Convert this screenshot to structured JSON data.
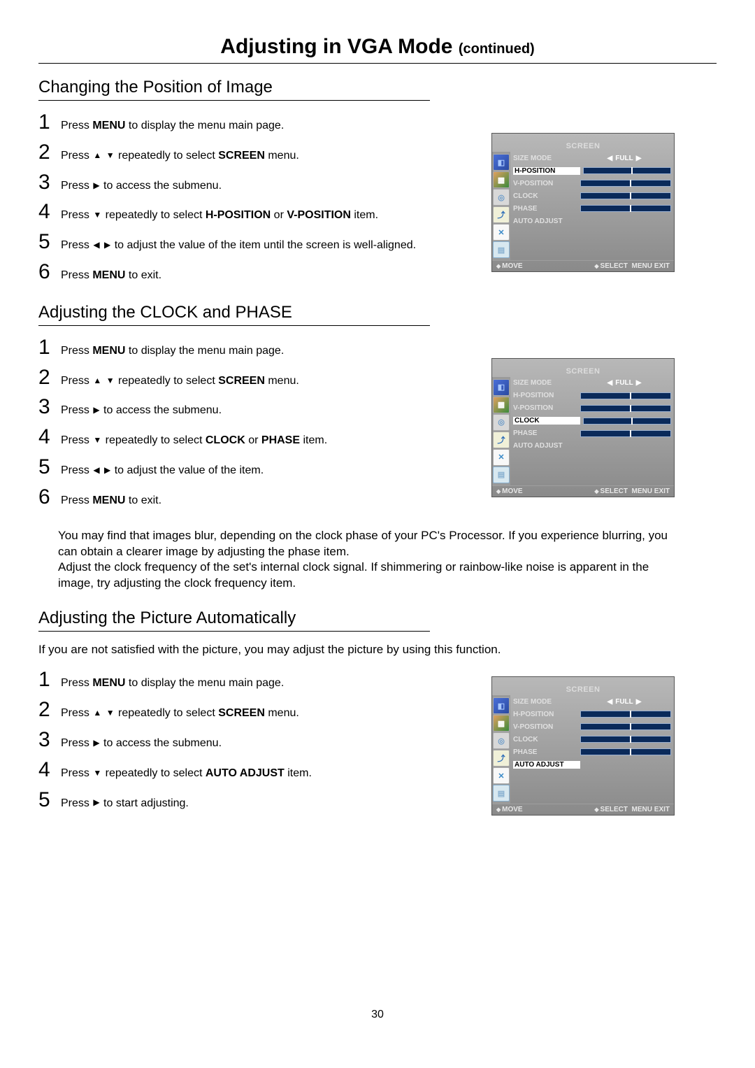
{
  "page": {
    "title": "Adjusting in VGA Mode",
    "title_suffix": "(continued)",
    "number": "30"
  },
  "osd": {
    "header": "SCREEN",
    "rows": {
      "size_mode": {
        "label": "SIZE MODE",
        "value": "FULL"
      },
      "h_position": {
        "label": "H-POSITION"
      },
      "v_position": {
        "label": "V-POSITION"
      },
      "clock": {
        "label": "CLOCK"
      },
      "phase": {
        "label": "PHASE"
      },
      "auto_adjust": {
        "label": "AUTO ADJUST"
      }
    },
    "footer": {
      "move": "MOVE",
      "select": "SELECT",
      "menu_exit": "MENU EXIT"
    }
  },
  "section1": {
    "title": "Changing the Position of Image",
    "steps": {
      "s1": {
        "n": "1",
        "pre": "Press ",
        "bold": "MENU",
        "post": " to display the menu main page."
      },
      "s2": {
        "n": "2",
        "pre": "Press ",
        "post": " repeatedly to select ",
        "bold": "SCREEN",
        "tail": " menu."
      },
      "s3": {
        "n": "3",
        "pre": "Press ",
        "post": " to access the submenu."
      },
      "s4": {
        "n": "4",
        "pre": "Press ",
        "post": " repeatedly  to select ",
        "bold1": "H-POSITION",
        "mid": " or ",
        "bold2": "V-POSITION",
        "tail": " item."
      },
      "s5": {
        "n": "5",
        "pre": "Press ",
        "post": " to adjust the value of the item until the screen is well-aligned."
      },
      "s6": {
        "n": "6",
        "pre": "Press ",
        "bold": "MENU",
        "post": " to exit."
      }
    }
  },
  "section2": {
    "title": "Adjusting the CLOCK and PHASE",
    "steps": {
      "s1": {
        "n": "1",
        "pre": "Press ",
        "bold": "MENU",
        "post": " to display the menu main page."
      },
      "s2": {
        "n": "2",
        "pre": "Press ",
        "post": " repeatedly to select ",
        "bold": "SCREEN",
        "tail": " menu."
      },
      "s3": {
        "n": "3",
        "pre": "Press ",
        "post": " to access the submenu."
      },
      "s4": {
        "n": "4",
        "pre": "Press ",
        "post": " repeatedly to select ",
        "bold1": "CLOCK",
        "mid": " or ",
        "bold2": "PHASE",
        "tail": " item."
      },
      "s5": {
        "n": "5",
        "pre": "Press ",
        "post": " to adjust the value of the item."
      },
      "s6": {
        "n": "6",
        "pre": "Press ",
        "bold": "MENU",
        "post": " to exit."
      }
    },
    "note1": "You may find that images blur, depending on the clock phase of your PC's Processor. If you experience blurring, you can obtain a clearer image by adjusting the phase item.",
    "note2": "Adjust the clock frequency of the set's internal clock signal. If shimmering or rainbow-like noise is apparent in the image, try adjusting the clock frequency item."
  },
  "section3": {
    "title": "Adjusting the Picture Automatically",
    "intro": "If you are not satisfied with the picture, you may adjust the picture by using this function.",
    "steps": {
      "s1": {
        "n": "1",
        "pre": "Press ",
        "bold": "MENU",
        "post": " to display the menu main page."
      },
      "s2": {
        "n": "2",
        "pre": "Press ",
        "post": " repeatedly to select ",
        "bold": "SCREEN",
        "tail": " menu."
      },
      "s3": {
        "n": "3",
        "pre": "Press ",
        "post": " to access the submenu."
      },
      "s4": {
        "n": "4",
        "pre": "Press ",
        "post": " repeatedly to select ",
        "bold": "AUTO ADJUST",
        "tail": " item."
      },
      "s5": {
        "n": "5",
        "pre": "Press ",
        "post": " to start adjusting."
      }
    }
  }
}
